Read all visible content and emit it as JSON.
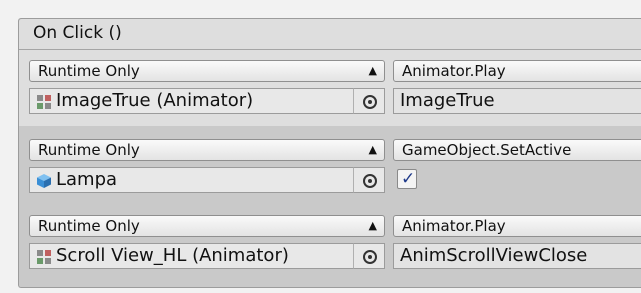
{
  "header": {
    "title": "On Click ()"
  },
  "entries": [
    {
      "mode": "Runtime Only",
      "function": "Animator.Play",
      "object": "ImageTrue (Animator)",
      "object_icon": "animator-icon",
      "argument": "ImageTrue",
      "argument_type": "text"
    },
    {
      "mode": "Runtime Only",
      "function": "GameObject.SetActive",
      "object": "Lampa",
      "object_icon": "gameobject-cube-icon",
      "argument_type": "checkbox",
      "argument_checked": true
    },
    {
      "mode": "Runtime Only",
      "function": "Animator.Play",
      "object": "Scroll View_HL (Animator)",
      "object_icon": "animator-icon",
      "argument": "AnimScrollViewClose",
      "argument_type": "text"
    }
  ],
  "colors": {
    "panel_bg": "#c9c9c9",
    "selected_row_bg": "#dedede",
    "checkmark": "#1f3a8a",
    "cube_icon": "#3a8fd6"
  }
}
